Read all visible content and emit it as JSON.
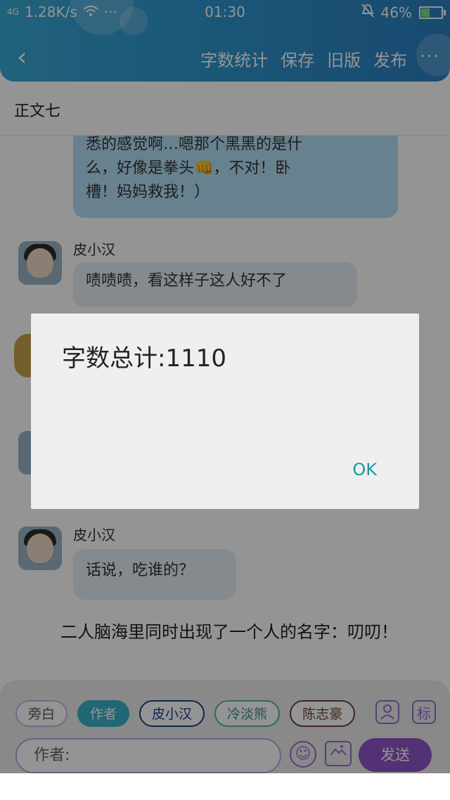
{
  "status_bar": {
    "network": "4G",
    "speed": "1.28K/s",
    "more": "···",
    "time": "01:30",
    "battery": "46%",
    "battery_level": 0.46
  },
  "nav": {
    "back": "‹",
    "actions": [
      "字数统计",
      "保存",
      "旧版",
      "发布"
    ],
    "more": "···"
  },
  "doc_title": "正文七",
  "messages": [
    {
      "text_lines": [
        "悉的感觉啊…嗯那个黑黑的是什",
        "么，好像是拳头👊，不对！卧",
        "槽！妈妈救我！）"
      ]
    },
    {
      "name": "皮小汉",
      "text": "啧啧啧，看这样子这人好不了"
    },
    {
      "name": "皮小汉",
      "text": "话说，吃谁的？"
    }
  ],
  "narration": "二人脑海里同时出现了一个人的名字：叨叨！",
  "dialog": {
    "total": "字数总计:1110",
    "ok": "OK"
  },
  "input_panel": {
    "roles": [
      "旁白",
      "作者",
      "皮小汉",
      "冷淡熊",
      "陈志豪"
    ],
    "active_role": "作者",
    "mark_icon": "标",
    "placeholder": "作者:",
    "send": "发送"
  }
}
